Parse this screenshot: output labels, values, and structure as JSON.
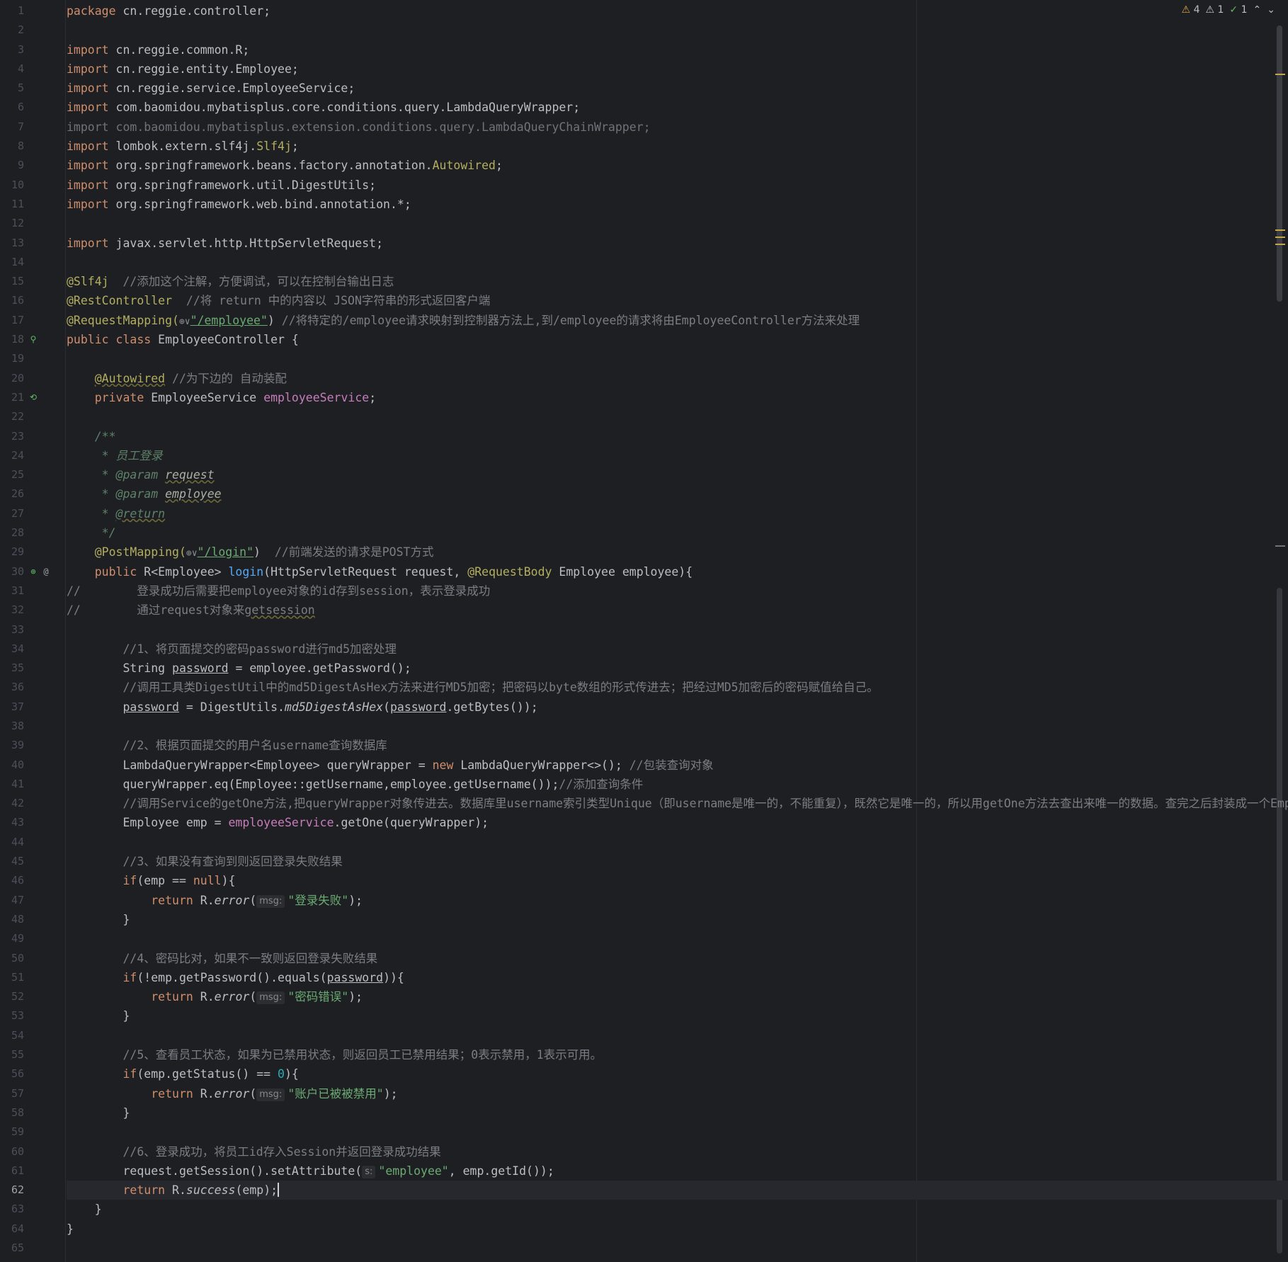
{
  "inspections": {
    "warnings": "4",
    "weak_warnings": "1",
    "ok": "1"
  },
  "current_line": 62,
  "line_numbers": [
    "1",
    "2",
    "3",
    "4",
    "5",
    "6",
    "7",
    "8",
    "9",
    "10",
    "11",
    "12",
    "13",
    "14",
    "15",
    "16",
    "17",
    "18",
    "19",
    "20",
    "21",
    "22",
    "23",
    "24",
    "25",
    "26",
    "27",
    "28",
    "29",
    "30",
    "31",
    "32",
    "33",
    "34",
    "35",
    "36",
    "37",
    "38",
    "39",
    "40",
    "41",
    "42",
    "43",
    "44",
    "45",
    "46",
    "47",
    "48",
    "49",
    "50",
    "51",
    "52",
    "53",
    "54",
    "55",
    "56",
    "57",
    "58",
    "59",
    "60",
    "61",
    "62",
    "63",
    "64",
    "65"
  ],
  "code": {
    "l1": [
      "package",
      " cn.reggie.controller;"
    ],
    "l3": [
      "import",
      " cn.reggie.common.R;"
    ],
    "l4": [
      "import",
      " cn.reggie.entity.Employee;"
    ],
    "l5": [
      "import",
      " cn.reggie.service.EmployeeService;"
    ],
    "l6": [
      "import",
      " com.baomidou.mybatisplus.core.conditions.query.LambdaQueryWrapper;"
    ],
    "l7": [
      "import com.baomidou.mybatisplus.extension.conditions.query.LambdaQueryChainWrapper;"
    ],
    "l8": [
      "import",
      " lombok.extern.slf4j.",
      "Slf4j",
      ";"
    ],
    "l9": [
      "import",
      " org.springframework.beans.factory.annotation.",
      "Autowired",
      ";"
    ],
    "l10": [
      "import",
      " org.springframework.util.DigestUtils;"
    ],
    "l11": [
      "import",
      " org.springframework.web.bind.annotation.*;"
    ],
    "l13": [
      "import",
      " javax.servlet.http.HttpServletRequest;"
    ],
    "l15": [
      "@Slf4j",
      "  //添加这个注解，方便调试，可以在控制台输出日志"
    ],
    "l16": [
      "@RestController",
      "  //将 return 中的内容以 JSON字符串的形式返回客户端"
    ],
    "l17": [
      "@RequestMapping(",
      "⊕",
      "∨",
      "\"/employee\"",
      ") ",
      "//将特定的/employee请求映射到控制器方法上,到/employee的请求将由EmployeeController方法来处理"
    ],
    "l18": [
      "public class",
      " EmployeeController {"
    ],
    "l20": [
      "@Autowired",
      " //为下边的 自动装配"
    ],
    "l21": [
      "private",
      " EmployeeService ",
      "employeeService",
      ";"
    ],
    "l23": [
      "/**"
    ],
    "l24": [
      " * 员工登录"
    ],
    "l25": [
      " * ",
      "@param",
      " ",
      "request"
    ],
    "l26": [
      " * ",
      "@param",
      " ",
      "employee"
    ],
    "l27": [
      " * ",
      "@return"
    ],
    "l28": [
      " */"
    ],
    "l29": [
      "@PostMapping(",
      "⊕",
      "∨",
      "\"/login\"",
      ")  ",
      "//前端发送的请求是POST方式"
    ],
    "l30": [
      "public",
      " R<Employee> ",
      "login",
      "(HttpServletRequest request, ",
      "@RequestBody",
      " Employee employee){"
    ],
    "l31": [
      "//        登录成功后需要把employee对象的id存到session，表示登录成功"
    ],
    "l32": [
      "//        通过request对象来",
      "getsession"
    ],
    "l34": [
      "//1、将页面提交的密码password进行md5加密处理"
    ],
    "l35": [
      "String ",
      "password",
      " = employee.getPassword();"
    ],
    "l36": [
      "//调用工具类DigestUtil中的md5DigestAsHex方法来进行MD5加密；把密码以byte数组的形式传进去；把经过MD5加密后的密码赋值给自己。"
    ],
    "l37": [
      "password",
      " = DigestUtils.",
      "md5DigestAsHex",
      "(",
      "password",
      ".getBytes());"
    ],
    "l39": [
      "//2、根据页面提交的用户名username查询数据库"
    ],
    "l40": [
      "LambdaQueryWrapper<Employee> queryWrapper = ",
      "new",
      " LambdaQueryWrapper<>(); ",
      "//包装查询对象"
    ],
    "l41": [
      "queryWrapper.eq(Employee::getUsername,employee.getUsername());",
      "//添加查询条件"
    ],
    "l42": [
      "//调用Service的getOne方法,把queryWrapper对象传进去。数据库里username索引类型Unique（即username是唯一的，不能重复），既然它是唯一的，所以用getOne方法去查出来唯一的数据。查完之后封装成一个Empl"
    ],
    "l43": [
      "Employee emp = ",
      "employeeService",
      ".getOne(queryWrapper);"
    ],
    "l45": [
      "//3、如果没有查询到则返回登录失败结果"
    ],
    "l46": [
      "if",
      "(emp == ",
      "null",
      "){"
    ],
    "l47": [
      "return",
      " R.",
      "error",
      "(",
      "msg:",
      "\"登录失败\"",
      ");"
    ],
    "l48": [
      "}"
    ],
    "l50": [
      "//4、密码比对，如果不一致则返回登录失败结果"
    ],
    "l51": [
      "if",
      "(!emp.getPassword().equals(",
      "password",
      ")){"
    ],
    "l52": [
      "return",
      " R.",
      "error",
      "(",
      "msg:",
      "\"密码错误\"",
      ");"
    ],
    "l53": [
      "}"
    ],
    "l55": [
      "//5、查看员工状态，如果为已禁用状态，则返回员工已禁用结果；0表示禁用，1表示可用。"
    ],
    "l56": [
      "if",
      "(emp.getStatus() == ",
      "0",
      "){"
    ],
    "l57": [
      "return",
      " R.",
      "error",
      "(",
      "msg:",
      "\"账户已被被禁用\"",
      ");"
    ],
    "l58": [
      "}"
    ],
    "l60": [
      "//6、登录成功，将员工id存入Session并返回登录成功结果"
    ],
    "l61": [
      "request.getSession().setAttribute(",
      "s:",
      "\"employee\"",
      ", emp.getId());"
    ],
    "l62": [
      "return",
      " R.",
      "success",
      "(emp);"
    ],
    "l63": [
      "}"
    ],
    "l64": [
      "}"
    ]
  },
  "icons": {
    "gutter_18": "bean-icon",
    "gutter_21": "autowired-bean-icon",
    "gutter_30a": "web-endpoint-icon",
    "gutter_30b": "annotation-at-icon"
  },
  "colors": {
    "background": "#1e1f22",
    "keyword": "#cf8e6d",
    "string": "#6aab73",
    "comment": "#7a7e85",
    "annotation": "#b3ae60",
    "field": "#c77dbb",
    "function": "#56a8f5",
    "number": "#2aacb8"
  }
}
